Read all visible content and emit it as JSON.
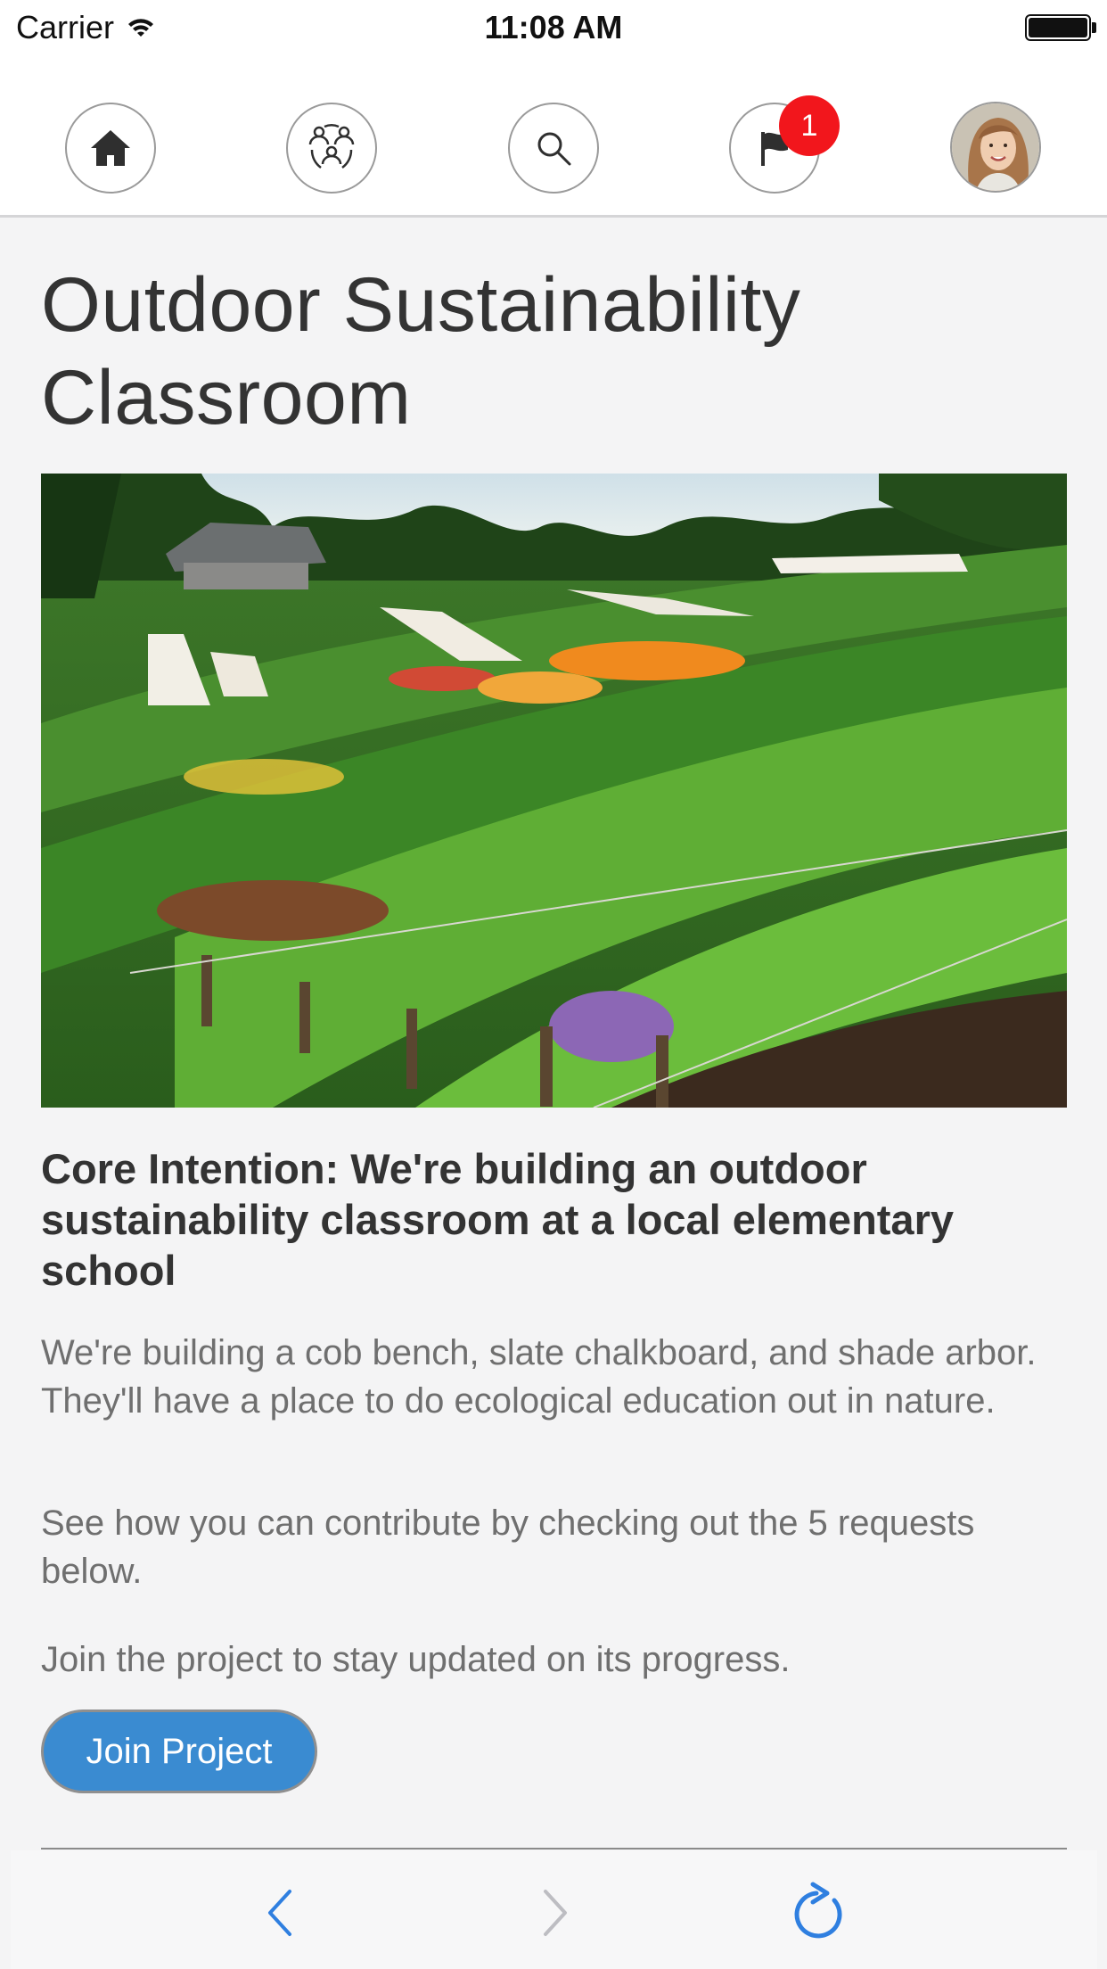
{
  "status_bar": {
    "carrier": "Carrier",
    "time": "11:08 AM"
  },
  "nav": {
    "items": [
      {
        "icon": "home-icon"
      },
      {
        "icon": "community-icon"
      },
      {
        "icon": "search-icon"
      },
      {
        "icon": "flag-icon",
        "badge": "1"
      },
      {
        "icon": "avatar"
      }
    ],
    "badge_color": "#f2161c"
  },
  "project": {
    "title": "Outdoor Sustainability Classroom",
    "intention": "Core Intention: We're building an outdoor sustainability classroom at a local elementary school",
    "description": "We're building a cob bench, slate chalkboard, and shade arbor. They'll have a place to do ecological education out in nature.",
    "requests_text": "See how you can contribute by checking out the 5 requests below.",
    "join_text": "Join the project to stay updated on its progress.",
    "join_button": "Join Project"
  },
  "colors": {
    "accent": "#3a8bd1",
    "toolbar_icon": "#2f7fe0",
    "toolbar_icon_disabled": "#bdbdc2"
  },
  "toolbar": {
    "icons": [
      "back-icon",
      "forward-icon",
      "reload-icon"
    ]
  }
}
